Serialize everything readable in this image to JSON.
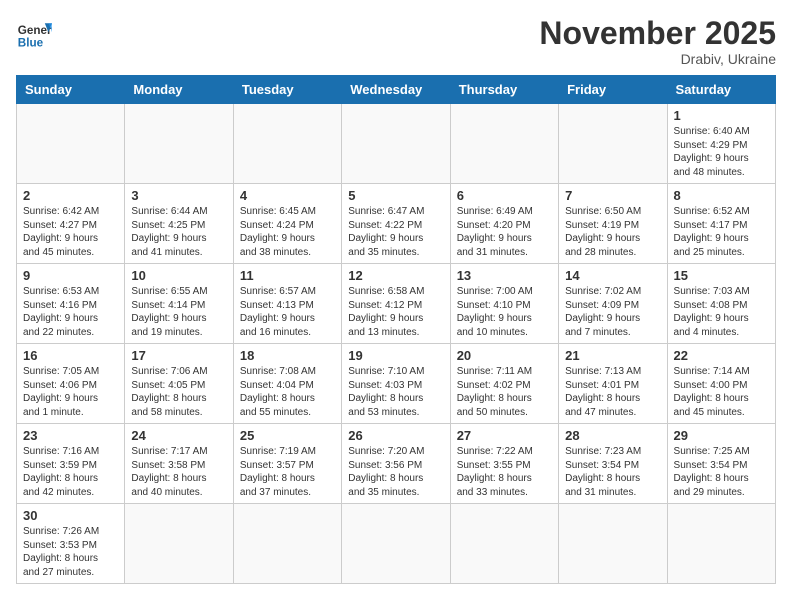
{
  "header": {
    "logo_line1": "General",
    "logo_line2": "Blue",
    "month_title": "November 2025",
    "location": "Drabiv, Ukraine"
  },
  "weekdays": [
    "Sunday",
    "Monday",
    "Tuesday",
    "Wednesday",
    "Thursday",
    "Friday",
    "Saturday"
  ],
  "weeks": [
    [
      {
        "day": "",
        "info": ""
      },
      {
        "day": "",
        "info": ""
      },
      {
        "day": "",
        "info": ""
      },
      {
        "day": "",
        "info": ""
      },
      {
        "day": "",
        "info": ""
      },
      {
        "day": "",
        "info": ""
      },
      {
        "day": "1",
        "info": "Sunrise: 6:40 AM\nSunset: 4:29 PM\nDaylight: 9 hours\nand 48 minutes."
      }
    ],
    [
      {
        "day": "2",
        "info": "Sunrise: 6:42 AM\nSunset: 4:27 PM\nDaylight: 9 hours\nand 45 minutes."
      },
      {
        "day": "3",
        "info": "Sunrise: 6:44 AM\nSunset: 4:25 PM\nDaylight: 9 hours\nand 41 minutes."
      },
      {
        "day": "4",
        "info": "Sunrise: 6:45 AM\nSunset: 4:24 PM\nDaylight: 9 hours\nand 38 minutes."
      },
      {
        "day": "5",
        "info": "Sunrise: 6:47 AM\nSunset: 4:22 PM\nDaylight: 9 hours\nand 35 minutes."
      },
      {
        "day": "6",
        "info": "Sunrise: 6:49 AM\nSunset: 4:20 PM\nDaylight: 9 hours\nand 31 minutes."
      },
      {
        "day": "7",
        "info": "Sunrise: 6:50 AM\nSunset: 4:19 PM\nDaylight: 9 hours\nand 28 minutes."
      },
      {
        "day": "8",
        "info": "Sunrise: 6:52 AM\nSunset: 4:17 PM\nDaylight: 9 hours\nand 25 minutes."
      }
    ],
    [
      {
        "day": "9",
        "info": "Sunrise: 6:53 AM\nSunset: 4:16 PM\nDaylight: 9 hours\nand 22 minutes."
      },
      {
        "day": "10",
        "info": "Sunrise: 6:55 AM\nSunset: 4:14 PM\nDaylight: 9 hours\nand 19 minutes."
      },
      {
        "day": "11",
        "info": "Sunrise: 6:57 AM\nSunset: 4:13 PM\nDaylight: 9 hours\nand 16 minutes."
      },
      {
        "day": "12",
        "info": "Sunrise: 6:58 AM\nSunset: 4:12 PM\nDaylight: 9 hours\nand 13 minutes."
      },
      {
        "day": "13",
        "info": "Sunrise: 7:00 AM\nSunset: 4:10 PM\nDaylight: 9 hours\nand 10 minutes."
      },
      {
        "day": "14",
        "info": "Sunrise: 7:02 AM\nSunset: 4:09 PM\nDaylight: 9 hours\nand 7 minutes."
      },
      {
        "day": "15",
        "info": "Sunrise: 7:03 AM\nSunset: 4:08 PM\nDaylight: 9 hours\nand 4 minutes."
      }
    ],
    [
      {
        "day": "16",
        "info": "Sunrise: 7:05 AM\nSunset: 4:06 PM\nDaylight: 9 hours\nand 1 minute."
      },
      {
        "day": "17",
        "info": "Sunrise: 7:06 AM\nSunset: 4:05 PM\nDaylight: 8 hours\nand 58 minutes."
      },
      {
        "day": "18",
        "info": "Sunrise: 7:08 AM\nSunset: 4:04 PM\nDaylight: 8 hours\nand 55 minutes."
      },
      {
        "day": "19",
        "info": "Sunrise: 7:10 AM\nSunset: 4:03 PM\nDaylight: 8 hours\nand 53 minutes."
      },
      {
        "day": "20",
        "info": "Sunrise: 7:11 AM\nSunset: 4:02 PM\nDaylight: 8 hours\nand 50 minutes."
      },
      {
        "day": "21",
        "info": "Sunrise: 7:13 AM\nSunset: 4:01 PM\nDaylight: 8 hours\nand 47 minutes."
      },
      {
        "day": "22",
        "info": "Sunrise: 7:14 AM\nSunset: 4:00 PM\nDaylight: 8 hours\nand 45 minutes."
      }
    ],
    [
      {
        "day": "23",
        "info": "Sunrise: 7:16 AM\nSunset: 3:59 PM\nDaylight: 8 hours\nand 42 minutes."
      },
      {
        "day": "24",
        "info": "Sunrise: 7:17 AM\nSunset: 3:58 PM\nDaylight: 8 hours\nand 40 minutes."
      },
      {
        "day": "25",
        "info": "Sunrise: 7:19 AM\nSunset: 3:57 PM\nDaylight: 8 hours\nand 37 minutes."
      },
      {
        "day": "26",
        "info": "Sunrise: 7:20 AM\nSunset: 3:56 PM\nDaylight: 8 hours\nand 35 minutes."
      },
      {
        "day": "27",
        "info": "Sunrise: 7:22 AM\nSunset: 3:55 PM\nDaylight: 8 hours\nand 33 minutes."
      },
      {
        "day": "28",
        "info": "Sunrise: 7:23 AM\nSunset: 3:54 PM\nDaylight: 8 hours\nand 31 minutes."
      },
      {
        "day": "29",
        "info": "Sunrise: 7:25 AM\nSunset: 3:54 PM\nDaylight: 8 hours\nand 29 minutes."
      }
    ],
    [
      {
        "day": "30",
        "info": "Sunrise: 7:26 AM\nSunset: 3:53 PM\nDaylight: 8 hours\nand 27 minutes."
      },
      {
        "day": "",
        "info": ""
      },
      {
        "day": "",
        "info": ""
      },
      {
        "day": "",
        "info": ""
      },
      {
        "day": "",
        "info": ""
      },
      {
        "day": "",
        "info": ""
      },
      {
        "day": "",
        "info": ""
      }
    ]
  ]
}
